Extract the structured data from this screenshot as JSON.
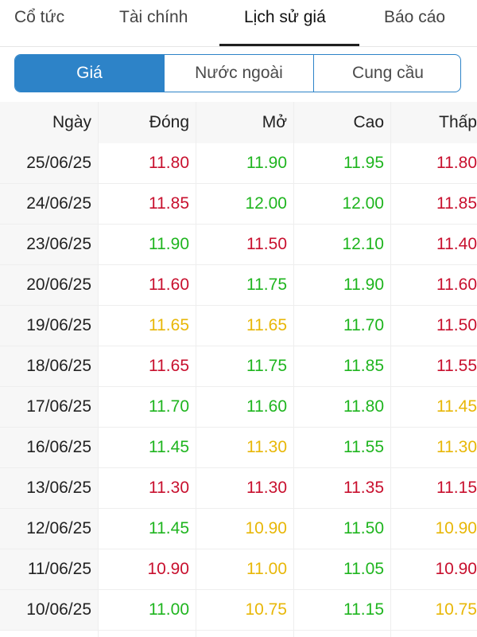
{
  "top_tabs": [
    {
      "label": "Cổ tức"
    },
    {
      "label": "Tài chính"
    },
    {
      "label": "Lịch sử giá"
    },
    {
      "label": "Báo cáo"
    }
  ],
  "segments": [
    {
      "label": "Giá"
    },
    {
      "label": "Nước ngoài"
    },
    {
      "label": "Cung cầu"
    }
  ],
  "table": {
    "headers": [
      "Ngày",
      "Đóng",
      "Mở",
      "Cao",
      "Thấp"
    ],
    "rows": [
      {
        "date": "25/06/25",
        "close": "11.80",
        "open": "11.90",
        "high": "11.95",
        "low": "11.80"
      },
      {
        "date": "24/06/25",
        "close": "11.85",
        "open": "12.00",
        "high": "12.00",
        "low": "11.85"
      },
      {
        "date": "23/06/25",
        "close": "11.90",
        "open": "11.50",
        "high": "12.10",
        "low": "11.40"
      },
      {
        "date": "20/06/25",
        "close": "11.60",
        "open": "11.75",
        "high": "11.90",
        "low": "11.60"
      },
      {
        "date": "19/06/25",
        "close": "11.65",
        "open": "11.65",
        "high": "11.70",
        "low": "11.50"
      },
      {
        "date": "18/06/25",
        "close": "11.65",
        "open": "11.75",
        "high": "11.85",
        "low": "11.55"
      },
      {
        "date": "17/06/25",
        "close": "11.70",
        "open": "11.60",
        "high": "11.80",
        "low": "11.45"
      },
      {
        "date": "16/06/25",
        "close": "11.45",
        "open": "11.30",
        "high": "11.55",
        "low": "11.30"
      },
      {
        "date": "13/06/25",
        "close": "11.30",
        "open": "11.30",
        "high": "11.35",
        "low": "11.15"
      },
      {
        "date": "12/06/25",
        "close": "11.45",
        "open": "10.90",
        "high": "11.50",
        "low": "10.90"
      },
      {
        "date": "11/06/25",
        "close": "10.90",
        "open": "11.00",
        "high": "11.05",
        "low": "10.90"
      },
      {
        "date": "10/06/25",
        "close": "11.00",
        "open": "10.75",
        "high": "11.15",
        "low": "10.75"
      }
    ],
    "cell_colors": [
      [
        "red",
        "green",
        "green",
        "red"
      ],
      [
        "red",
        "green",
        "green",
        "red"
      ],
      [
        "green",
        "red",
        "green",
        "red"
      ],
      [
        "red",
        "green",
        "green",
        "red"
      ],
      [
        "yellow",
        "yellow",
        "green",
        "red"
      ],
      [
        "red",
        "green",
        "green",
        "red"
      ],
      [
        "green",
        "green",
        "green",
        "yellow"
      ],
      [
        "green",
        "yellow",
        "green",
        "yellow"
      ],
      [
        "red",
        "red",
        "red",
        "red"
      ],
      [
        "green",
        "yellow",
        "green",
        "yellow"
      ],
      [
        "red",
        "yellow",
        "green",
        "red"
      ],
      [
        "green",
        "yellow",
        "green",
        "yellow"
      ]
    ]
  },
  "colors": {
    "red": "#c8102e",
    "green": "#1fb51f",
    "yellow": "#e8b708",
    "accent": "#2d83c8"
  }
}
